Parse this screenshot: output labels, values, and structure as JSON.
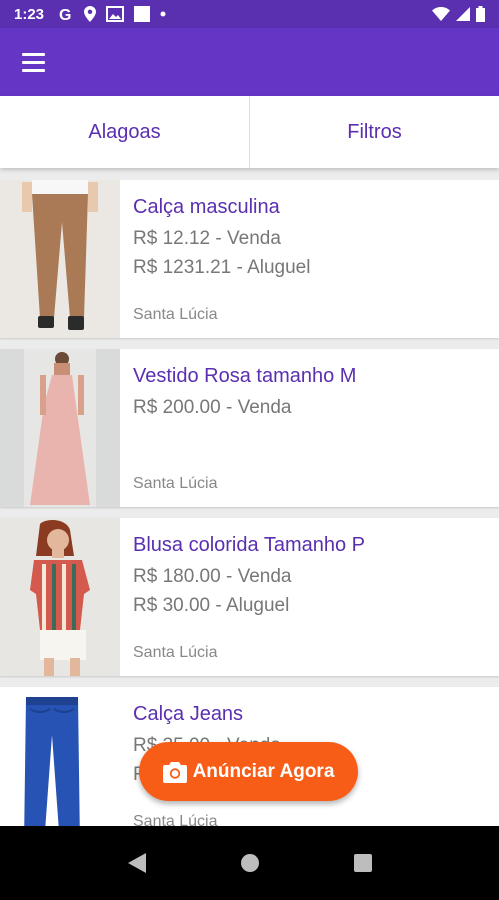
{
  "status_bar": {
    "time": "1:23",
    "icons": [
      "google-icon",
      "location-icon",
      "gallery-icon",
      "square-icon",
      "dot-icon"
    ],
    "right_icons": [
      "wifi-icon",
      "signal-icon",
      "battery-icon"
    ]
  },
  "app_bar": {
    "menu_icon": "menu-icon"
  },
  "tabs": [
    {
      "label": "Alagoas"
    },
    {
      "label": "Filtros"
    }
  ],
  "listings": [
    {
      "title": "Calça masculina",
      "price1": "R$ 12.12 - Venda",
      "price2": "R$ 1231.21 - Aluguel",
      "location": "Santa Lúcia"
    },
    {
      "title": "Vestido Rosa tamanho M",
      "price1": "R$ 200.00 - Venda",
      "price2": "",
      "location": "Santa Lúcia"
    },
    {
      "title": "Blusa colorida Tamanho P",
      "price1": "R$ 180.00 - Venda",
      "price2": "R$ 30.00 - Aluguel",
      "location": "Santa Lúcia"
    },
    {
      "title": "Calça Jeans",
      "price1": "R$ 35.00 - Venda",
      "price2": "R$",
      "location": "Santa Lúcia"
    }
  ],
  "fab": {
    "label": "Anúnciar Agora",
    "icon": "camera-icon"
  },
  "colors": {
    "primary": "#6535c6",
    "status_bar": "#5a2fb0",
    "accent": "#f85d18",
    "title_text": "#5a2fb0"
  }
}
